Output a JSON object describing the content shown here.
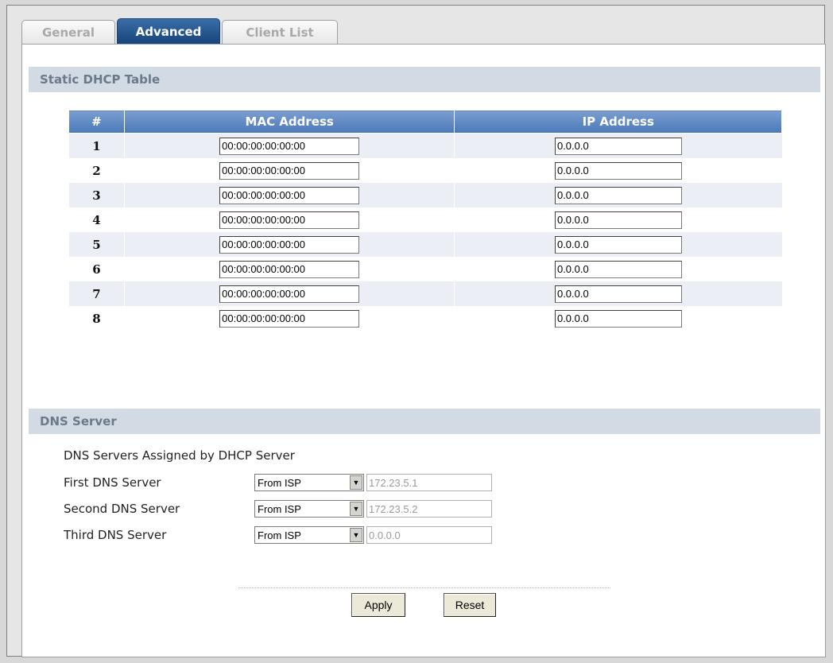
{
  "tabs": [
    {
      "label": "General",
      "active": false
    },
    {
      "label": "Advanced",
      "active": true
    },
    {
      "label": "Client List",
      "active": false
    }
  ],
  "static_dhcp": {
    "title": "Static DHCP Table",
    "columns": [
      "#",
      "MAC Address",
      "IP Address"
    ],
    "rows": [
      {
        "num": "1",
        "mac": "00:00:00:00:00:00",
        "ip": "0.0.0.0"
      },
      {
        "num": "2",
        "mac": "00:00:00:00:00:00",
        "ip": "0.0.0.0"
      },
      {
        "num": "3",
        "mac": "00:00:00:00:00:00",
        "ip": "0.0.0.0"
      },
      {
        "num": "4",
        "mac": "00:00:00:00:00:00",
        "ip": "0.0.0.0"
      },
      {
        "num": "5",
        "mac": "00:00:00:00:00:00",
        "ip": "0.0.0.0"
      },
      {
        "num": "6",
        "mac": "00:00:00:00:00:00",
        "ip": "0.0.0.0"
      },
      {
        "num": "7",
        "mac": "00:00:00:00:00:00",
        "ip": "0.0.0.0"
      },
      {
        "num": "8",
        "mac": "00:00:00:00:00:00",
        "ip": "0.0.0.0"
      }
    ]
  },
  "dns": {
    "title": "DNS Server",
    "subtitle": "DNS Servers Assigned by DHCP Server",
    "servers": [
      {
        "label": "First DNS Server",
        "mode": "From ISP",
        "ip": "172.23.5.1"
      },
      {
        "label": "Second DNS Server",
        "mode": "From ISP",
        "ip": "172.23.5.2"
      },
      {
        "label": "Third DNS Server",
        "mode": "From ISP",
        "ip": "0.0.0.0"
      }
    ]
  },
  "buttons": {
    "apply": "Apply",
    "reset": "Reset"
  },
  "icons": {
    "dropdown": "chevron-down-icon"
  },
  "colors": {
    "tab_active": "#17447a",
    "table_header": "#4a78b8",
    "section_bar": "#d2dae3",
    "row_alt": "#ebeff5"
  }
}
